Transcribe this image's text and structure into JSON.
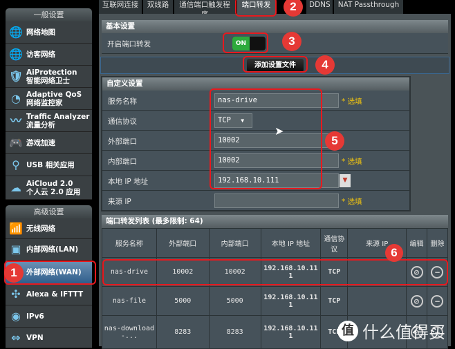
{
  "sidebar": {
    "general_title": "一般设置",
    "general_items": [
      {
        "l1": "网络地图",
        "l2": "",
        "icon": "globe-map-icon"
      },
      {
        "l1": "访客网络",
        "l2": "",
        "icon": "guest-network-icon"
      },
      {
        "l1": "AiProtection",
        "l2": "智能网络卫士",
        "icon": "shield-lock-icon"
      },
      {
        "l1": "Adaptive QoS",
        "l2": "网络监控家",
        "icon": "gauge-icon"
      },
      {
        "l1": "Traffic Analyzer",
        "l2": "流量分析",
        "icon": "traffic-wave-icon"
      },
      {
        "l1": "游戏加速",
        "l2": "",
        "icon": "gamepad-icon"
      },
      {
        "l1": "USB 相关应用",
        "l2": "",
        "icon": "usb-icon"
      },
      {
        "l1": "AiCloud 2.0",
        "l2": "个人云 2.0 应用",
        "icon": "cloud-icon"
      }
    ],
    "advanced_title": "高级设置",
    "advanced_items": [
      {
        "l1": "无线网络",
        "icon": "wireless-icon"
      },
      {
        "l1": "内部网络(LAN)",
        "icon": "lan-icon"
      },
      {
        "l1": "外部网络(WAN)",
        "icon": "wan-globe-icon",
        "selected": true
      },
      {
        "l1": "Alexa & IFTTT",
        "icon": "alexa-icon"
      },
      {
        "l1": "IPv6",
        "icon": "ipv6-icon"
      },
      {
        "l1": "VPN",
        "icon": "vpn-icon"
      }
    ]
  },
  "tabs": [
    "互联网连接",
    "双线路",
    "通信端口触发程序",
    "端口转发",
    "DDNS",
    "NAT Passthrough"
  ],
  "active_tab": "端口转发",
  "basic": {
    "title": "基本设置",
    "enable_label": "开启端口转发",
    "toggle": "ON",
    "toggle_on": true
  },
  "add_button": "添加设置文件",
  "custom": {
    "title": "自定义设置",
    "fields": [
      {
        "label": "服务名称",
        "value": "nas-drive",
        "hint": "* 选填"
      },
      {
        "label": "通信协议",
        "value": "TCP",
        "hint": ""
      },
      {
        "label": "外部端口",
        "value": "10002",
        "hint": ""
      },
      {
        "label": "内部端口",
        "value": "10002",
        "hint": "* 选填"
      },
      {
        "label": "本地 IP 地址",
        "value": "192.168.10.111",
        "hint": ""
      },
      {
        "label": "来源 IP",
        "value": "",
        "hint": "* 选填"
      }
    ]
  },
  "list": {
    "title": "端口转发列表 (最多限制: 64)",
    "headers": [
      "服务名称",
      "外部端口",
      "内部端口",
      "本地 IP 地址",
      "通信协议",
      "来源 IP",
      "编辑",
      "删除"
    ],
    "rows": [
      [
        "nas-drive",
        "10002",
        "10002",
        "192.168.10.111",
        "TCP",
        ""
      ],
      [
        "nas-file",
        "5000",
        "5000",
        "192.168.10.111",
        "TCP",
        ""
      ],
      [
        "nas-download-...",
        "8283",
        "8283",
        "192.168.10.111",
        "TCP",
        ""
      ]
    ]
  },
  "annotations": [
    "1",
    "2",
    "3",
    "4",
    "5",
    "6"
  ],
  "watermark": "什么值得买",
  "watermark_logo": "值",
  "colors": {
    "annotation": "#e53935",
    "toggle_on": "#2eaa3c",
    "hint": "#f1c40f",
    "selected": "#2f5e8c"
  }
}
